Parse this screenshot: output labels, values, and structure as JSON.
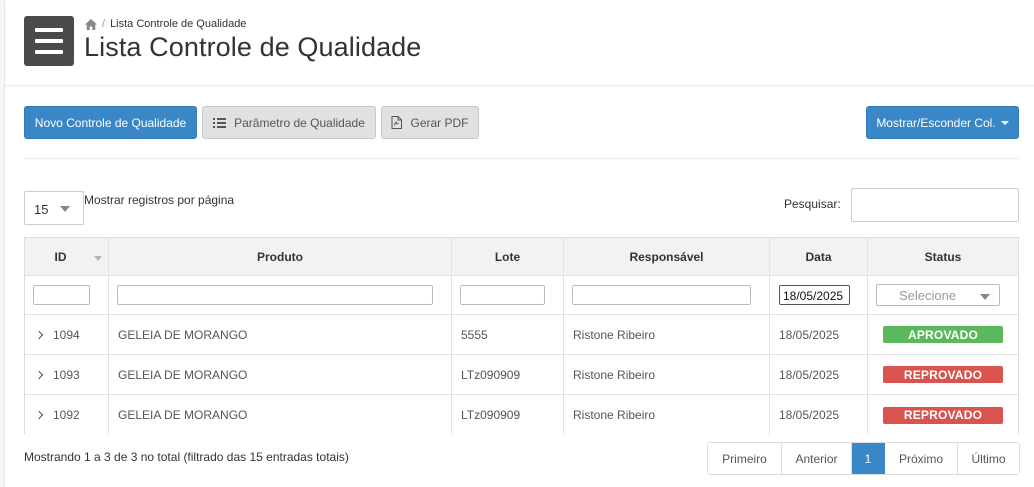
{
  "breadcrumb": {
    "current": "Lista Controle de Qualidade"
  },
  "page_title": "Lista Controle de Qualidade",
  "toolbar": {
    "new_label": "Novo Controle de Qualidade",
    "param_label": "Parâmetro de Qualidade",
    "pdf_label": "Gerar PDF",
    "columns_label": "Mostrar/Esconder Col."
  },
  "length": {
    "value": "15",
    "label": "Mostrar registros por página"
  },
  "search": {
    "label": "Pesquisar:",
    "value": ""
  },
  "table": {
    "columns": [
      "ID",
      "Produto",
      "Lote",
      "Responsável",
      "Data",
      "Status"
    ],
    "filters": {
      "id": "",
      "produto": "",
      "lote": "",
      "responsavel": "",
      "data": "18/05/2025",
      "status_placeholder": "Selecione"
    },
    "rows": [
      {
        "id": "1094",
        "produto": "GELEIA DE MORANGO",
        "lote": "5555",
        "responsavel": "Ristone Ribeiro",
        "data": "18/05/2025",
        "status": "APROVADO"
      },
      {
        "id": "1093",
        "produto": "GELEIA DE MORANGO",
        "lote": "LTz090909",
        "responsavel": "Ristone Ribeiro",
        "data": "18/05/2025",
        "status": "REPROVADO"
      },
      {
        "id": "1092",
        "produto": "GELEIA DE MORANGO",
        "lote": "LTz090909",
        "responsavel": "Ristone Ribeiro",
        "data": "18/05/2025",
        "status": "REPROVADO"
      }
    ]
  },
  "status_colors": {
    "APROVADO": "#5cb85c",
    "REPROVADO": "#d9534f"
  },
  "info": "Mostrando 1 a 3 de 3 no total (filtrado das 15 entradas totais)",
  "pagination": {
    "first": "Primeiro",
    "prev": "Anterior",
    "current": "1",
    "next": "Próximo",
    "last": "Último"
  },
  "icons": {
    "menu": "hamburger-icon",
    "home": "home-icon",
    "list": "list-icon",
    "pdf": "pdf-file-icon"
  }
}
